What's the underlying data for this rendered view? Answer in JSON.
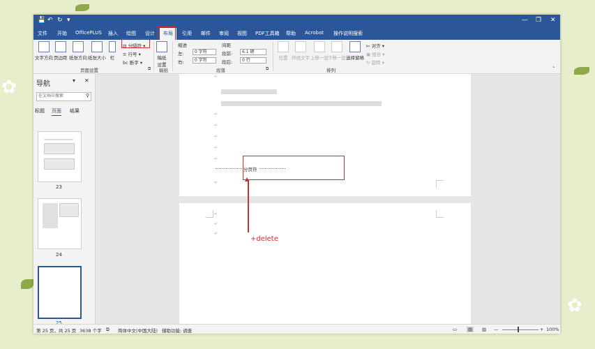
{
  "titlebar": {
    "quick_access": [
      "💾",
      "↶",
      "↻",
      "▾"
    ],
    "window_controls": [
      "—",
      "❐",
      "✕"
    ]
  },
  "tabs": [
    "文件",
    "开始",
    "OfficePLUS",
    "插入",
    "绘图",
    "设计",
    "布局",
    "引用",
    "邮件",
    "审阅",
    "视图",
    "PDF工具箱",
    "帮助",
    "Acrobat",
    "操作说明搜索"
  ],
  "active_tab": "布局",
  "ribbon": {
    "page_setup": {
      "text_direction": "文字方向",
      "margins": "页边距",
      "orientation": "纸张方向",
      "size": "纸张大小",
      "columns": "栏",
      "breaks": "分隔符",
      "line_numbers": "行号",
      "hyphenation": "断字",
      "group_label": "页面设置"
    },
    "manuscript": {
      "label": "稿纸\n设置",
      "group_label": "稿纸"
    },
    "paragraph": {
      "indent_title": "缩进",
      "spacing_title": "间距",
      "left_label": "左:",
      "left_value": "0 字符",
      "right_label": "右:",
      "right_value": "0 字符",
      "before_label": "段前:",
      "before_value": "6.1 磅",
      "after_label": "段后:",
      "after_value": "0 行",
      "group_label": "段落"
    },
    "arrange": {
      "position": "位置",
      "wrap_text": "环绕文字",
      "bring_forward": "上移一层",
      "send_backward": "下移一层",
      "selection_pane": "选择窗格",
      "align": "对齐",
      "group": "组合",
      "rotate": "旋转",
      "group_label": "排列"
    }
  },
  "nav": {
    "title": "导航",
    "search_placeholder": "在文档中搜索",
    "tabs": [
      "标题",
      "页面",
      "结果"
    ],
    "page_numbers": [
      "23",
      "24",
      "25"
    ]
  },
  "document": {
    "page_break_label": "分页符",
    "annotation": "+delete"
  },
  "status": {
    "page": "第 25 页，共 25 页",
    "words": "3638 个字",
    "language": "简体中文(中国大陆)",
    "accessibility": "辅助功能: 调查",
    "zoom": "100%"
  }
}
